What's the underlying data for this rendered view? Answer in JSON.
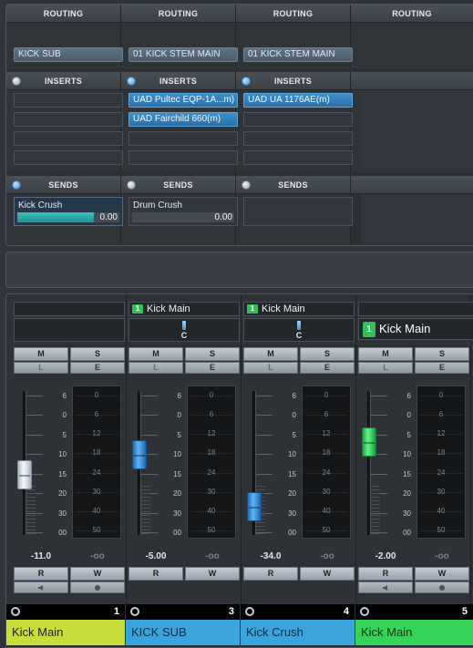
{
  "routing": {
    "headers": [
      "ROUTING",
      "ROUTING",
      "ROUTING",
      "ROUTING"
    ],
    "values": [
      "KICK SUB",
      "01 KICK STEM MAIN",
      "01 KICK STEM MAIN"
    ]
  },
  "inserts": {
    "headers": [
      "INSERTS",
      "INSERTS",
      "INSERTS"
    ],
    "ch2_slot1": "UAD Pultec EQP-1A...m)",
    "ch2_slot2": "UAD Fairchild 660(m)",
    "ch3_slot1": "UAD UA 1176AE(m)"
  },
  "sends": {
    "headers": [
      "SENDS",
      "SENDS",
      "SENDS"
    ],
    "ch1_name": "Kick Crush",
    "ch1_value": "0.00",
    "ch1_fill": 0.75,
    "ch2_name": "Drum Crush",
    "ch2_value": "0.00",
    "ch2_fill": 0.0
  },
  "mixer": {
    "group_badge": "1",
    "output_ch2": "Kick Main",
    "output_ch3": "Kick Main",
    "output_ch4": "Kick Main",
    "pan_ch2": "C",
    "pan_ch3": "C",
    "buttons": {
      "mute": "M",
      "solo": "S",
      "listen": "L",
      "edit": "E",
      "read": "R",
      "write": "W"
    },
    "fader_scale": [
      "6",
      "0",
      "5",
      "10",
      "15",
      "20",
      "30",
      "00"
    ],
    "meter_scale": [
      "0",
      "6",
      "12",
      "18",
      "24",
      "30",
      "40",
      "50"
    ],
    "fader_levels": [
      0.6,
      0.43,
      0.88,
      0.32
    ],
    "volumes": [
      "-11.0",
      "-5.00",
      "-34.0",
      "-2.00"
    ],
    "peaks": [
      "-oo",
      "-oo",
      "-oo",
      "-oo"
    ],
    "channel_numbers": [
      "1",
      "3",
      "4",
      "5"
    ],
    "channel_names": [
      "Kick Main",
      "KICK SUB",
      "Kick Crush",
      "Kick Main"
    ],
    "colors": {
      "ch1": "#c8dc3c",
      "ch2": "#3aa4dc",
      "ch3": "#3aa4dc",
      "ch4": "#36d35a",
      "fader_white": "#e6ecf2",
      "fader_blue": "#3a9ae0",
      "fader_green": "#3ee06a"
    }
  }
}
